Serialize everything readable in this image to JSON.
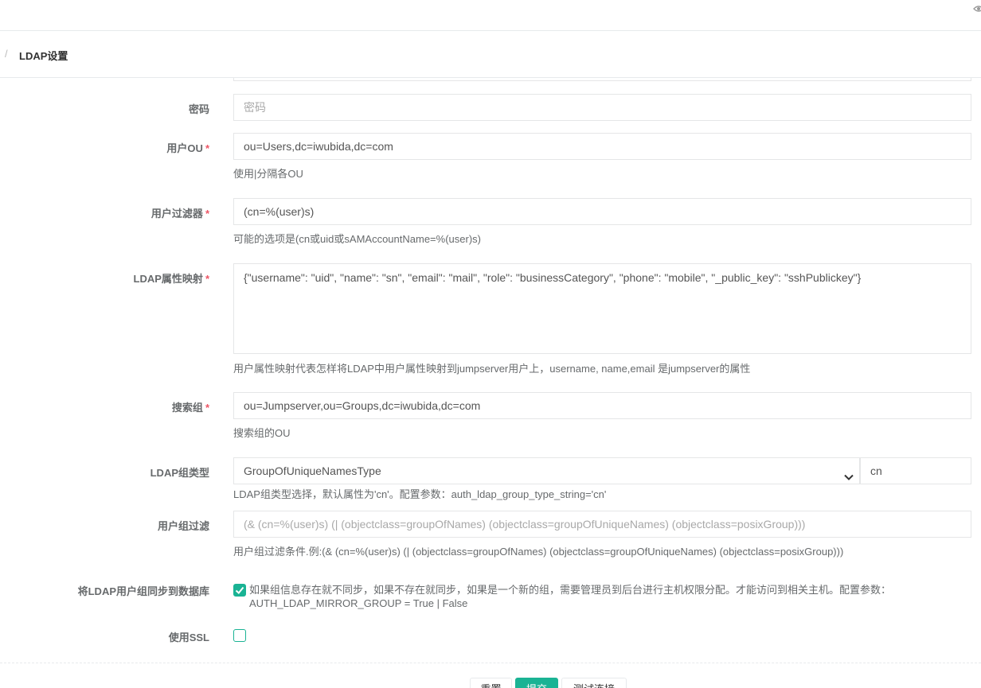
{
  "topbar": {
    "icon": "eye-icon"
  },
  "breadcrumb": {
    "separator": "/",
    "current": "LDAP设置"
  },
  "form": {
    "password": {
      "label": "密码",
      "placeholder": "密码"
    },
    "user_ou": {
      "label": "用户OU",
      "required": "*",
      "value": "ou=Users,dc=iwubida,dc=com",
      "help": "使用|分隔各OU"
    },
    "user_filter": {
      "label": "用户过滤器",
      "required": "*",
      "value": "(cn=%(user)s)",
      "help": "可能的选项是(cn或uid或sAMAccountName=%(user)s)"
    },
    "attr_map": {
      "label": "LDAP属性映射",
      "required": "*",
      "value": "{\"username\": \"uid\", \"name\": \"sn\", \"email\": \"mail\", \"role\": \"businessCategory\", \"phone\": \"mobile\", \"_public_key\": \"sshPublickey\"}",
      "help": "用户属性映射代表怎样将LDAP中用户属性映射到jumpserver用户上，username, name,email 是jumpserver的属性"
    },
    "search_group": {
      "label": "搜索组",
      "required": "*",
      "value": "ou=Jumpserver,ou=Groups,dc=iwubida,dc=com",
      "help": "搜索组的OU"
    },
    "group_type": {
      "label": "LDAP组类型",
      "selected": "GroupOfUniqueNamesType",
      "param": "cn",
      "help": "LDAP组类型选择，默认属性为'cn'。配置参数：auth_ldap_group_type_string='cn'"
    },
    "group_filter": {
      "label": "用户组过滤",
      "placeholder": "(& (cn=%(user)s) (| (objectclass=groupOfNames) (objectclass=groupOfUniqueNames) (objectclass=posixGroup)))",
      "help": "用户组过滤条件.例:(& (cn=%(user)s) (| (objectclass=groupOfNames) (objectclass=groupOfUniqueNames) (objectclass=posixGroup)))"
    },
    "mirror_group": {
      "label": "将LDAP用户组同步到数据库",
      "checked": true,
      "text": "如果组信息存在就不同步，如果不存在就同步，如果是一个新的组，需要管理员到后台进行主机权限分配。才能访问到相关主机。配置参数：AUTH_LDAP_MIRROR_GROUP = True | False"
    },
    "use_ssl": {
      "label": "使用SSL",
      "checked": false
    }
  },
  "buttons": {
    "reset": "重置",
    "submit": "提交",
    "test": "测试连接"
  },
  "colors": {
    "accent": "#1ab394",
    "required": "#ed5565"
  }
}
